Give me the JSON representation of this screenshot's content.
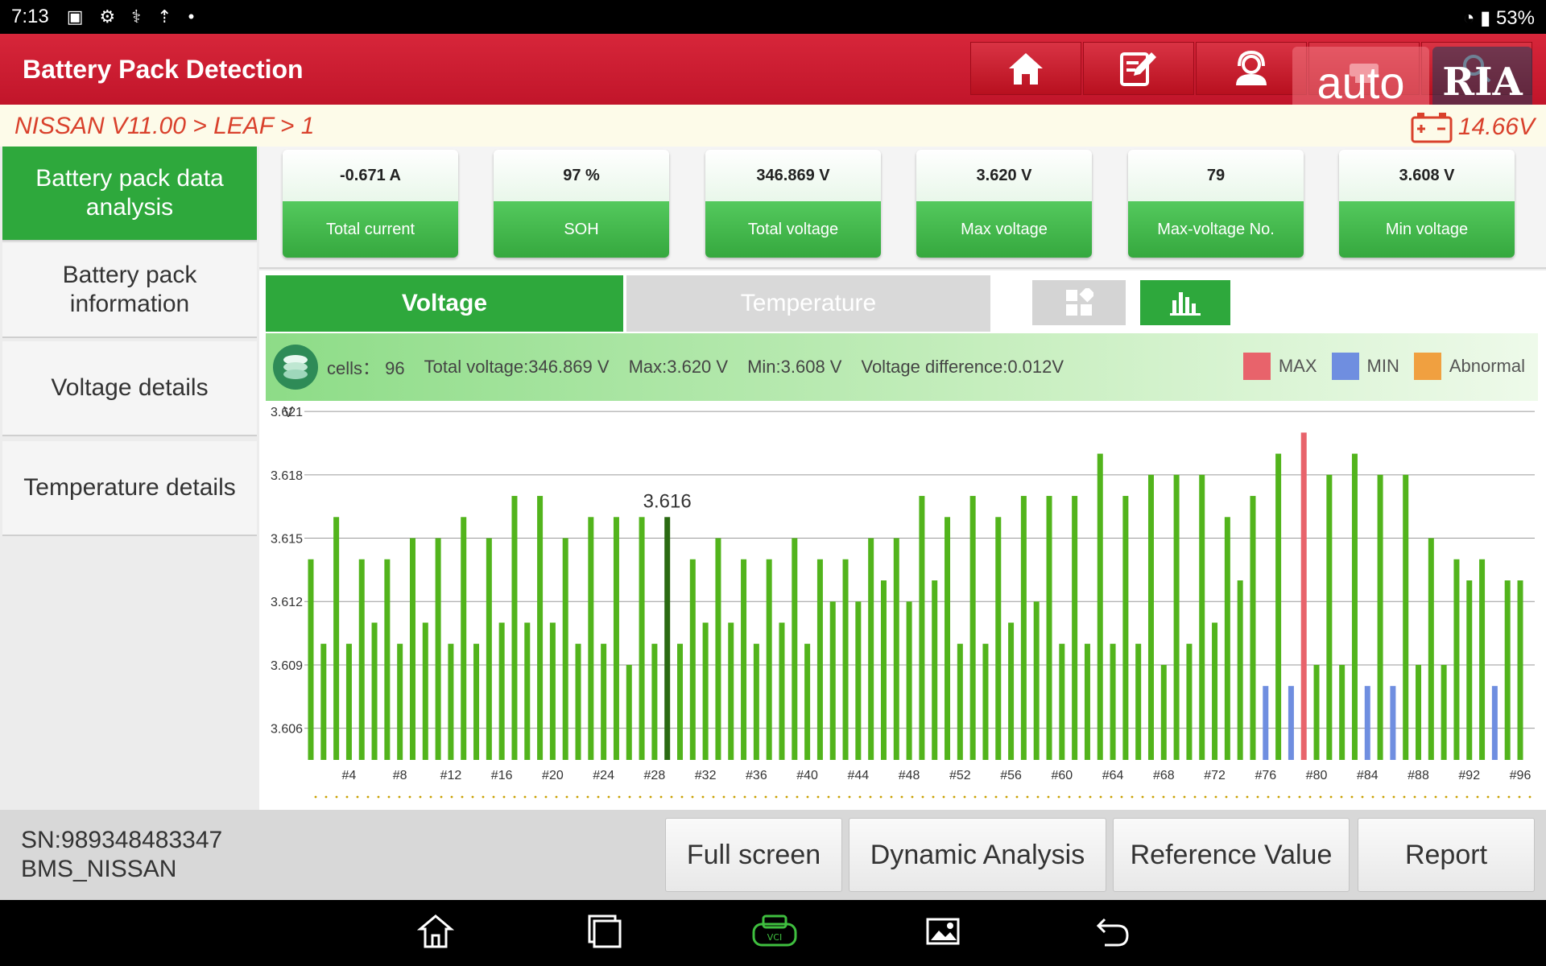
{
  "status_bar": {
    "time": "7:13",
    "battery": "53%"
  },
  "header": {
    "title": "Battery Pack Detection"
  },
  "watermark": {
    "text_auto": "auto",
    "text_ria": "RIA"
  },
  "breadcrumb": {
    "path": "NISSAN V11.00 > LEAF  > 1",
    "battery_voltage": "14.66V"
  },
  "sidebar": {
    "items": [
      {
        "label": "Battery pack data analysis",
        "active": true
      },
      {
        "label": "Battery pack information",
        "active": false
      },
      {
        "label": "Voltage details",
        "active": false
      },
      {
        "label": "Temperature details",
        "active": false
      }
    ]
  },
  "cards": [
    {
      "value": "-0.671 A",
      "label": "Total current"
    },
    {
      "value": "97 %",
      "label": "SOH"
    },
    {
      "value": "346.869 V",
      "label": "Total voltage"
    },
    {
      "value": "3.620 V",
      "label": "Max voltage"
    },
    {
      "value": "79",
      "label": "Max-voltage No."
    },
    {
      "value": "3.608 V",
      "label": "Min voltage"
    }
  ],
  "tabs": {
    "voltage": "Voltage",
    "temperature": "Temperature"
  },
  "info": {
    "cells": "cells：  96",
    "total_voltage": "Total voltage:346.869 V",
    "max": "Max:3.620 V",
    "min": "Min:3.608 V",
    "difference": "Voltage difference:0.012V"
  },
  "legend": {
    "max_label": "MAX",
    "min_label": "MIN",
    "abnormal_label": "Abnormal",
    "max_color": "#e8636b",
    "min_color": "#6f8ee0",
    "abnormal_color": "#f0a040"
  },
  "chart_data": {
    "type": "bar",
    "ylabel": "V",
    "ylim": [
      3.6045,
      3.6215
    ],
    "yticks": [
      "3.621",
      "3.618",
      "3.615",
      "3.612",
      "3.609",
      "3.606"
    ],
    "x_ticks": [
      "#4",
      "#8",
      "#12",
      "#16",
      "#20",
      "#24",
      "#28",
      "#32",
      "#36",
      "#40",
      "#44",
      "#48",
      "#52",
      "#56",
      "#60",
      "#64",
      "#68",
      "#72",
      "#76",
      "#80",
      "#84",
      "#88",
      "#92",
      "#96"
    ],
    "highlight": {
      "cell": 29,
      "label": "3.616"
    },
    "normal_color": "#52b41c",
    "selected_color": "#2a6a12",
    "values": [
      3.614,
      3.61,
      3.616,
      3.61,
      3.614,
      3.611,
      3.614,
      3.61,
      3.615,
      3.611,
      3.615,
      3.61,
      3.616,
      3.61,
      3.615,
      3.611,
      3.617,
      3.611,
      3.617,
      3.611,
      3.615,
      3.61,
      3.616,
      3.61,
      3.616,
      3.609,
      3.616,
      3.61,
      3.616,
      3.61,
      3.614,
      3.611,
      3.615,
      3.611,
      3.614,
      3.61,
      3.614,
      3.611,
      3.615,
      3.61,
      3.614,
      3.612,
      3.614,
      3.612,
      3.615,
      3.613,
      3.615,
      3.612,
      3.617,
      3.613,
      3.616,
      3.61,
      3.617,
      3.61,
      3.616,
      3.611,
      3.617,
      3.612,
      3.617,
      3.61,
      3.617,
      3.61,
      3.619,
      3.61,
      3.617,
      3.61,
      3.618,
      3.609,
      3.618,
      3.61,
      3.618,
      3.611,
      3.616,
      3.613,
      3.617,
      3.608,
      3.619,
      3.608,
      3.62,
      3.609,
      3.618,
      3.609,
      3.619,
      3.608,
      3.618,
      3.608,
      3.618,
      3.609,
      3.615,
      3.609,
      3.614,
      3.613,
      3.614,
      3.608,
      3.613,
      3.613
    ],
    "max_cells": [
      79
    ],
    "min_cells": [
      76,
      78,
      84,
      86,
      94
    ]
  },
  "bottom": {
    "sn": "SN:989348483347",
    "bms": "BMS_NISSAN",
    "buttons": {
      "full_screen": "Full screen",
      "dynamic": "Dynamic Analysis",
      "reference": "Reference Value",
      "report": "Report"
    }
  }
}
